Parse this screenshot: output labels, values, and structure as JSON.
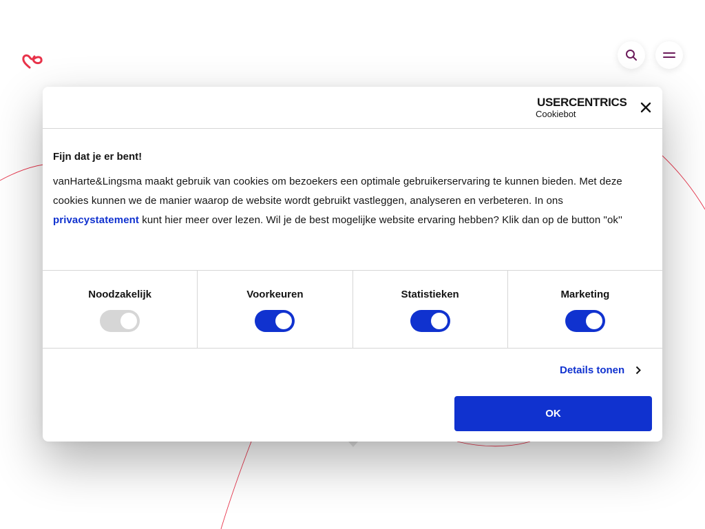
{
  "site": {
    "logo_icon": "heart-infinity-logo-icon",
    "search_icon": "search-icon",
    "menu_icon": "hamburger-menu-icon",
    "brand_color": "#e8334a",
    "accent_color": "#6b1a5a"
  },
  "dialog": {
    "provider_logo": {
      "brand": "USERCENTRICS",
      "product": "Cookiebot"
    },
    "close_icon": "close-icon",
    "title": "Fijn dat je er bent!",
    "text_part1": "vanHarte&Lingsma maakt gebruik van cookies om bezoekers een optimale gebruikerservaring te kunnen bieden. Met deze cookies kunnen we de manier waarop de website wordt gebruikt vastleggen, analyseren en verbeteren. In ons ",
    "privacy_link": "privacystatement",
    "text_part2": " kunt hier meer over lezen. Wil je de best mogelijke website ervaring hebben? Klik dan op de button \"ok''",
    "categories": [
      {
        "label": "Noodzakelijk",
        "enabled": true,
        "disabled": true
      },
      {
        "label": "Voorkeuren",
        "enabled": true,
        "disabled": false
      },
      {
        "label": "Statistieken",
        "enabled": true,
        "disabled": false
      },
      {
        "label": "Marketing",
        "enabled": true,
        "disabled": false
      }
    ],
    "details_label": "Details tonen",
    "ok_label": "OK",
    "button_color": "#1032cf"
  }
}
